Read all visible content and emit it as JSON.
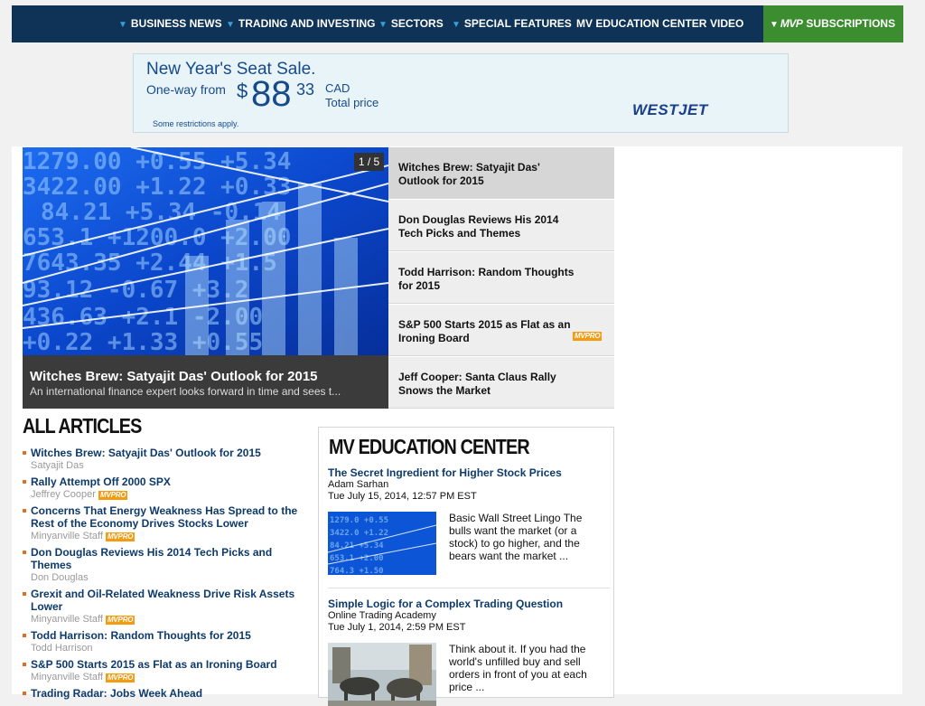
{
  "nav": {
    "items": [
      {
        "label": "BUSINESS NEWS",
        "dropdown": true
      },
      {
        "label": "TRADING AND INVESTING",
        "dropdown": true
      },
      {
        "label": "SECTORS",
        "dropdown": true
      },
      {
        "label": "SPECIAL FEATURES",
        "dropdown": true
      },
      {
        "label": "MV EDUCATION CENTER",
        "dropdown": false
      },
      {
        "label": "VIDEO",
        "dropdown": false
      }
    ],
    "subscriptions": {
      "logo": "MVP",
      "label": "SUBSCRIPTIONS"
    }
  },
  "ad": {
    "headline": "New Year's Seat Sale.",
    "oneway": "One-way from",
    "currency_symbol": "$",
    "price": "88",
    "cents": "33",
    "currency": "CAD",
    "total": "Total price",
    "restrictions": "Some restrictions apply.",
    "brand": "WESTJET"
  },
  "slider": {
    "counter": "1 / 5",
    "caption_title": "Witches Brew: Satyajit Das' Outlook for 2015",
    "caption_desc": "An international finance expert looks forward in time and sees t...",
    "items": [
      {
        "title": "Witches Brew: Satyajit Das' Outlook for 2015",
        "pro": false
      },
      {
        "title": "Don Douglas Reviews His 2014 Tech Picks and Themes",
        "pro": false
      },
      {
        "title": "Todd Harrison: Random Thoughts for 2015",
        "pro": false
      },
      {
        "title": "S&P 500 Starts 2015 as Flat as an Ironing Board",
        "pro": true
      },
      {
        "title": "Jeff Cooper: Santa Claus Rally Snows the Market",
        "pro": false
      }
    ],
    "pro_badge": "MVPRO"
  },
  "articles": {
    "heading": "ALL ARTICLES",
    "items": [
      {
        "title": "Witches Brew: Satyajit Das' Outlook for 2015",
        "author": "Satyajit Das",
        "pro": false
      },
      {
        "title": "Rally Attempt Off 2000 SPX",
        "author": "Jeffrey Cooper",
        "pro": true
      },
      {
        "title": "Concerns That Energy Weakness Has Spread to the Rest of the Economy Drives Stocks Lower",
        "author": "Minyanville Staff",
        "pro": true
      },
      {
        "title": "Don Douglas Reviews His 2014 Tech Picks and Themes",
        "author": "Don Douglas",
        "pro": false
      },
      {
        "title": "Grexit and Oil-Related Weakness Drive Risk Assets Lower",
        "author": "Minyanville Staff",
        "pro": true
      },
      {
        "title": "Todd Harrison: Random Thoughts for 2015",
        "author": "Todd Harrison",
        "pro": false
      },
      {
        "title": "S&P 500 Starts 2015 as Flat as an Ironing Board",
        "author": "Minyanville Staff",
        "pro": true
      },
      {
        "title": "Trading Radar: Jobs Week Ahead",
        "author": "",
        "pro": false
      }
    ]
  },
  "education": {
    "heading": "MV EDUCATION CENTER",
    "items": [
      {
        "title": "The Secret Ingredient for Higher Stock Prices",
        "author": "Adam Sarhan",
        "date": "Tue July 15, 2014, 12:57 PM EST",
        "excerpt": "Basic Wall Street Lingo   The bulls want the market (or a stock) to go higher, and the bears want the market ..."
      },
      {
        "title": "Simple Logic for a Complex Trading Question",
        "author": "Online Trading Academy",
        "date": "Tue July 1, 2014, 2:59 PM EST",
        "excerpt": "Think about it. If you had the world's unfilled buy and sell orders in front of you at each price ..."
      }
    ]
  }
}
